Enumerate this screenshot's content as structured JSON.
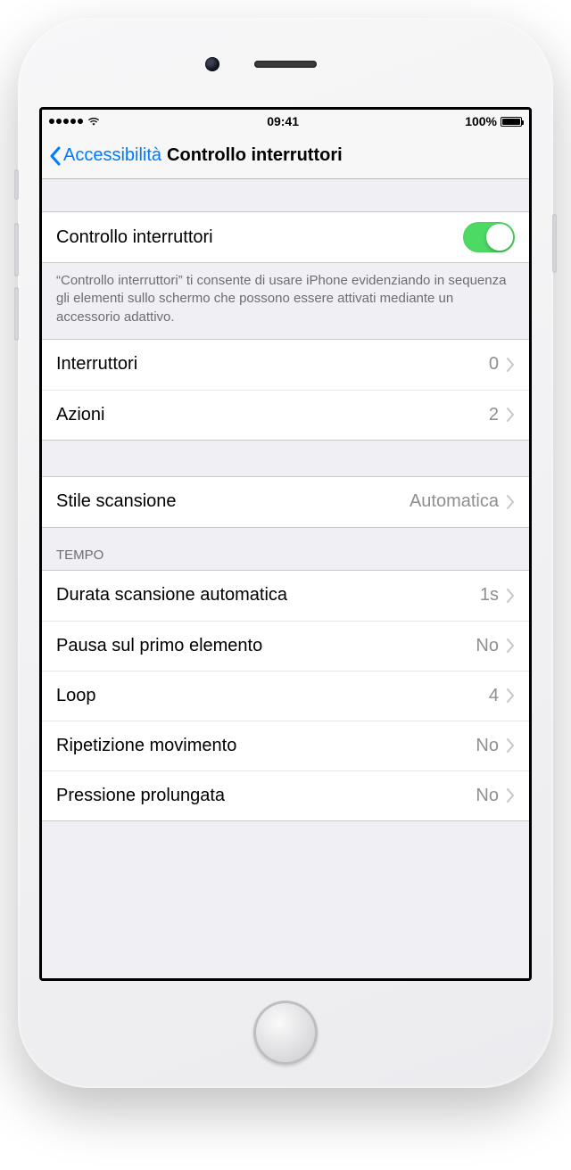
{
  "statusbar": {
    "time": "09:41",
    "battery_pct": "100%"
  },
  "nav": {
    "back_label": "Accessibilità",
    "title": "Controllo interruttori"
  },
  "main_toggle": {
    "label": "Controllo interruttori",
    "on": true
  },
  "description": "“Controllo interruttori” ti consente di usare iPhone evidenziando in sequenza gli elementi sullo schermo che possono essere attivati mediante un accessorio adattivo.",
  "config": {
    "switches_label": "Interruttori",
    "switches_value": "0",
    "actions_label": "Azioni",
    "actions_value": "2"
  },
  "scanstyle": {
    "label": "Stile scansione",
    "value": "Automatica"
  },
  "tempo": {
    "header": "Tempo",
    "rows": [
      {
        "label": "Durata scansione automatica",
        "value": "1s"
      },
      {
        "label": "Pausa sul primo elemento",
        "value": "No"
      },
      {
        "label": "Loop",
        "value": "4"
      },
      {
        "label": "Ripetizione movimento",
        "value": "No"
      },
      {
        "label": "Pressione prolungata",
        "value": "No"
      }
    ]
  }
}
